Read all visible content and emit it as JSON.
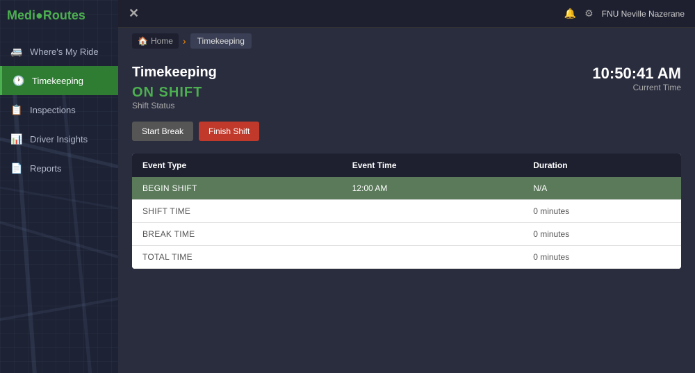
{
  "app": {
    "name_prefix": "Medi",
    "name_suffix": "Routes",
    "logo_dot": "●"
  },
  "topbar": {
    "close_icon": "✕",
    "settings_icon": "⚙",
    "notification_icon": "🔔",
    "user_name": "FNU Neville Nazerane"
  },
  "sidebar": {
    "items": [
      {
        "id": "wheres-my-ride",
        "label": "Where's My Ride",
        "icon": "🚐",
        "active": false
      },
      {
        "id": "timekeeping",
        "label": "Timekeeping",
        "icon": "🕐",
        "active": true
      },
      {
        "id": "inspections",
        "label": "Inspections",
        "icon": "📋",
        "active": false
      },
      {
        "id": "driver-insights",
        "label": "Driver Insights",
        "icon": "📊",
        "active": false
      },
      {
        "id": "reports",
        "label": "Reports",
        "icon": "📄",
        "active": false
      }
    ]
  },
  "breadcrumb": {
    "home_label": "Home",
    "current_label": "Timekeeping"
  },
  "page": {
    "title": "Timekeeping",
    "shift_status": "ON SHIFT",
    "shift_status_sub": "Shift Status",
    "current_time": "10:50:41 AM",
    "current_time_label": "Current Time",
    "buttons": {
      "start_break": "Start Break",
      "finish_shift": "Finish Shift"
    },
    "table": {
      "columns": [
        "Event Type",
        "Event Time",
        "Duration"
      ],
      "rows": [
        {
          "event_type": "Begin Shift",
          "event_time": "12:00 AM",
          "duration": "N/A",
          "highlighted": true
        },
        {
          "event_type": "SHIFT TIME",
          "event_time": "",
          "duration": "0 minutes",
          "highlighted": false
        },
        {
          "event_type": "BREAK TIME",
          "event_time": "",
          "duration": "0 minutes",
          "highlighted": false
        },
        {
          "event_type": "TOTAL TIME",
          "event_time": "",
          "duration": "0 minutes",
          "highlighted": false
        }
      ]
    }
  }
}
